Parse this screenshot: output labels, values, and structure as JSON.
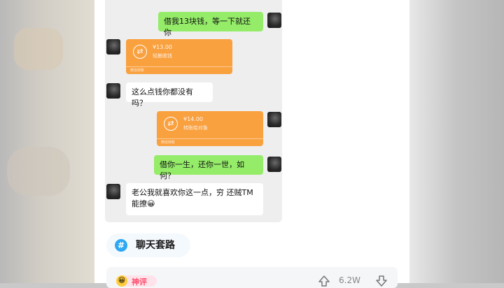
{
  "chat": {
    "messages": [
      {
        "type": "text",
        "side": "right",
        "text": "借我13块钱，等一下就还你"
      },
      {
        "type": "transfer",
        "side": "left",
        "amount": "¥13.00",
        "status": "轻触收钱",
        "footer": "微信转账"
      },
      {
        "type": "text",
        "side": "left",
        "text": "这么点钱你都没有吗？"
      },
      {
        "type": "transfer",
        "side": "right",
        "amount": "¥14.00",
        "status": "转账给对象",
        "footer": "微信转账"
      },
      {
        "type": "text",
        "side": "right",
        "text": "借你一生，还你一世，如何？"
      },
      {
        "type": "text",
        "side": "left",
        "line1": "老公我就喜欢你这一点，穷 还贼TM",
        "line2": "能撩😀"
      }
    ]
  },
  "topic": {
    "hash": "#",
    "label": "聊天套路"
  },
  "bottom": {
    "badge": "神评",
    "badge_emoji": "😀",
    "like_count": "6.2W"
  },
  "colors": {
    "sent_bubble": "#95ec69",
    "transfer": "#f9a03f",
    "topic_accent": "#2ea7f5",
    "badge_text": "#ff4d6d"
  }
}
